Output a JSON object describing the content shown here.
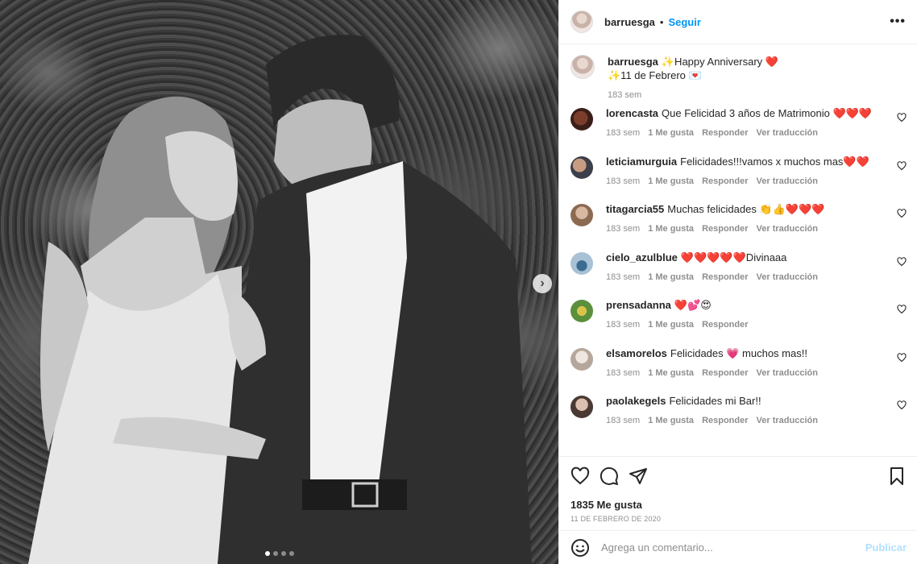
{
  "post": {
    "carousel": {
      "total_slides": 4,
      "active_slide": 1
    }
  },
  "header": {
    "username": "barruesga",
    "separator": "•",
    "follow_label": "Seguir",
    "more_label": "•••"
  },
  "caption": {
    "username": "barruesga",
    "line1": "✨Happy Anniversary ❤️",
    "line2": "✨11 de Febrero 💌",
    "time": "183 sem"
  },
  "comments": [
    {
      "username": "lorencasta",
      "text": "Que Felicidad 3 años de Matrimonio ❤️❤️❤️",
      "time": "183 sem",
      "likes": "1 Me gusta",
      "reply": "Responder",
      "translate": "Ver traducción"
    },
    {
      "username": "leticiamurguia",
      "text": "Felicidades!!!vamos x muchos mas❤️❤️",
      "time": "183 sem",
      "likes": "1 Me gusta",
      "reply": "Responder",
      "translate": "Ver traducción"
    },
    {
      "username": "titagarcia55",
      "text": "Muchas felicidades 👏👍❤️❤️❤️",
      "time": "183 sem",
      "likes": "1 Me gusta",
      "reply": "Responder",
      "translate": "Ver traducción"
    },
    {
      "username": "cielo_azulblue",
      "text": "❤️❤️❤️❤️❤️Divinaaa",
      "time": "183 sem",
      "likes": "1 Me gusta",
      "reply": "Responder",
      "translate": "Ver traducción"
    },
    {
      "username": "prensadanna",
      "text": "❤️💕😍",
      "time": "183 sem",
      "likes": "1 Me gusta",
      "reply": "Responder",
      "translate": ""
    },
    {
      "username": "elsamorelos",
      "text": "Felicidades 💗 muchos mas!!",
      "time": "183 sem",
      "likes": "1 Me gusta",
      "reply": "Responder",
      "translate": "Ver traducción"
    },
    {
      "username": "paolakegels",
      "text": "Felicidades mi Bar!!",
      "time": "183 sem",
      "likes": "1 Me gusta",
      "reply": "Responder",
      "translate": "Ver traducción"
    }
  ],
  "footer": {
    "likes": "1835 Me gusta",
    "date": "11 DE FEBRERO DE 2020"
  },
  "add_comment": {
    "placeholder": "Agrega un comentario...",
    "publish_label": "Publicar"
  },
  "icons": {
    "like": "heart-outline-icon",
    "comment": "speech-bubble-icon",
    "share": "paper-plane-icon",
    "save": "bookmark-icon",
    "emoji": "smiley-icon",
    "next": "chevron-right-icon"
  },
  "colors": {
    "follow": "#0095f6",
    "publish_disabled": "#b2dffc",
    "muted": "#8e8e8e",
    "heart": "#ed4956"
  }
}
